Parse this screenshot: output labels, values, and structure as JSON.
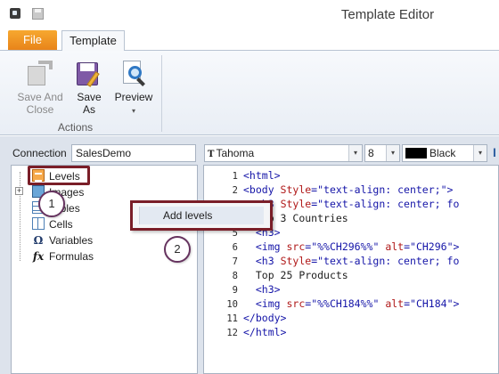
{
  "window": {
    "title": "Template Editor"
  },
  "ribbon": {
    "tabs": {
      "file": "File",
      "template": "Template"
    },
    "save_and_close": {
      "line1": "Save And",
      "line2": "Close"
    },
    "save_as": {
      "line1": "Save",
      "line2": "As"
    },
    "preview": {
      "label": "Preview",
      "caret": "▾"
    },
    "group_label": "Actions"
  },
  "connection": {
    "label": "Connection",
    "value": "SalesDemo"
  },
  "tree": {
    "items": [
      {
        "label": "Levels",
        "icon": "levels-icon"
      },
      {
        "label": "Images",
        "icon": "images-icon"
      },
      {
        "label": "Tables",
        "icon": "tables-icon"
      },
      {
        "label": "Cells",
        "icon": "cells-icon"
      },
      {
        "label": "Variables",
        "icon": "omega-icon",
        "glyph": "Ω"
      },
      {
        "label": "Formulas",
        "icon": "fx-icon",
        "glyph": "fx"
      }
    ],
    "expander": "+"
  },
  "context_menu": {
    "items": [
      {
        "label": "Add levels"
      }
    ]
  },
  "callouts": {
    "one": "1",
    "two": "2"
  },
  "editor_toolbar": {
    "font": "Tahoma",
    "font_glyph": "T",
    "size": "8",
    "color_name": "Black",
    "color_hex": "#000000",
    "dropdown_arrow": "▾"
  },
  "code": {
    "lines": [
      {
        "num": "1",
        "indent": "",
        "parts": [
          [
            "tag",
            "<html>"
          ]
        ]
      },
      {
        "num": "2",
        "indent": "",
        "parts": [
          [
            "tag",
            "<body "
          ],
          [
            "attr",
            "Style"
          ],
          [
            "tag",
            "="
          ],
          [
            "val",
            "\"text-align: center;\""
          ],
          [
            "tag",
            ">"
          ]
        ]
      },
      {
        "num": "3",
        "indent": "  ",
        "parts": [
          [
            "tag",
            "<h3 "
          ],
          [
            "attr",
            "Style"
          ],
          [
            "tag",
            "="
          ],
          [
            "val",
            "\"text-align: center; fo"
          ]
        ]
      },
      {
        "num": "4",
        "indent": "  ",
        "parts": [
          [
            "txt",
            "Top 3 Countries"
          ]
        ]
      },
      {
        "num": "5",
        "indent": "  ",
        "parts": [
          [
            "tag",
            "<h3>"
          ]
        ]
      },
      {
        "num": "6",
        "indent": "  ",
        "parts": [
          [
            "tag",
            "<img "
          ],
          [
            "attr",
            "src"
          ],
          [
            "tag",
            "="
          ],
          [
            "val",
            "\"%%CH296%%\""
          ],
          [
            "tag",
            " "
          ],
          [
            "attr",
            "alt"
          ],
          [
            "tag",
            "="
          ],
          [
            "val",
            "\"CH296\""
          ],
          [
            "tag",
            ">"
          ]
        ]
      },
      {
        "num": "7",
        "indent": "  ",
        "parts": [
          [
            "tag",
            "<h3 "
          ],
          [
            "attr",
            "Style"
          ],
          [
            "tag",
            "="
          ],
          [
            "val",
            "\"text-align: center; fo"
          ]
        ]
      },
      {
        "num": "8",
        "indent": "  ",
        "parts": [
          [
            "txt",
            "Top 25 Products"
          ]
        ]
      },
      {
        "num": "9",
        "indent": "  ",
        "parts": [
          [
            "tag",
            "<h3>"
          ]
        ]
      },
      {
        "num": "10",
        "indent": "  ",
        "parts": [
          [
            "tag",
            "<img "
          ],
          [
            "attr",
            "src"
          ],
          [
            "tag",
            "="
          ],
          [
            "val",
            "\"%%CH184%%\""
          ],
          [
            "tag",
            " "
          ],
          [
            "attr",
            "alt"
          ],
          [
            "tag",
            "="
          ],
          [
            "val",
            "\"CH184\""
          ],
          [
            "tag",
            ">"
          ]
        ]
      },
      {
        "num": "11",
        "indent": "",
        "parts": [
          [
            "tag",
            "</body>"
          ]
        ]
      },
      {
        "num": "12",
        "indent": "",
        "parts": [
          [
            "tag",
            "</html>"
          ]
        ]
      }
    ]
  },
  "colors": {
    "file_tab": "#f39c23",
    "highlight_border": "#7a1e28",
    "callout_border": "#66335f"
  }
}
